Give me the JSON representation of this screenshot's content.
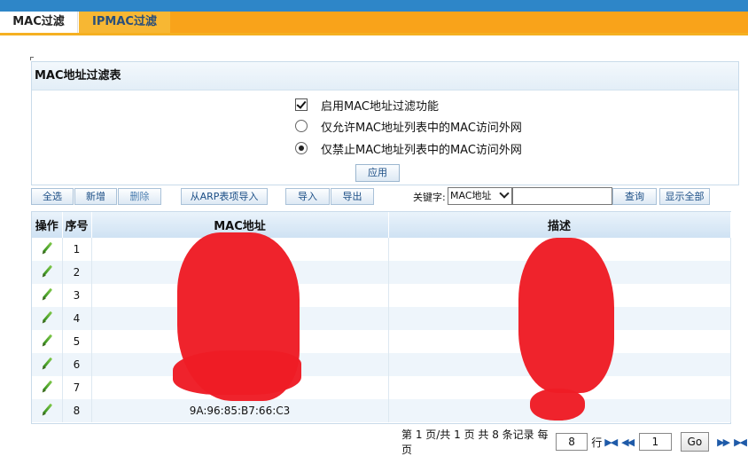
{
  "tabs": [
    {
      "label": "MAC过滤",
      "active": true
    },
    {
      "label": "IPMAC过滤",
      "active": false
    }
  ],
  "panel": {
    "title": "MAC地址过滤表",
    "enable_label": "启用MAC地址过滤功能",
    "enable_checked": true,
    "allow_label": "仅允许MAC地址列表中的MAC访问外网",
    "deny_label": "仅禁止MAC地址列表中的MAC访问外网",
    "selected_mode": "deny",
    "apply_label": "应用"
  },
  "toolbar": {
    "select_all": "全选",
    "add": "新增",
    "delete": "删除",
    "import_arp": "从ARP表项导入",
    "import": "导入",
    "export": "导出",
    "keyword_label": "关键字:",
    "keyword_option": "MAC地址",
    "keyword_value": "",
    "search": "查询",
    "show_all": "显示全部"
  },
  "table": {
    "headers": [
      "操作",
      "序号",
      "MAC地址",
      "描述"
    ],
    "rows": [
      {
        "index": "1",
        "mac": "",
        "desc": ""
      },
      {
        "index": "2",
        "mac": "",
        "desc": ""
      },
      {
        "index": "3",
        "mac": "",
        "desc": ""
      },
      {
        "index": "4",
        "mac": "",
        "desc": ""
      },
      {
        "index": "5",
        "mac": "",
        "desc": ""
      },
      {
        "index": "6",
        "mac": "",
        "desc": ""
      },
      {
        "index": "7",
        "mac": "",
        "desc": ""
      },
      {
        "index": "8",
        "mac": "9A:96:85:B7:66:C3",
        "desc": ""
      }
    ]
  },
  "pager": {
    "summary": "第 1 页/共 1 页 共 8 条记录 每页",
    "per_page": "8",
    "rows_unit": "行",
    "page_value": "1",
    "go_label": "Go"
  },
  "colors": {
    "tab_accent": "#f9a31a",
    "top_bar": "#2e86c8",
    "redaction": "#ee1c25"
  }
}
